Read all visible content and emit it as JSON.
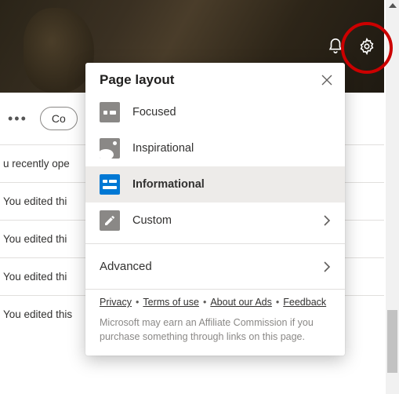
{
  "header": {
    "icons": {
      "bell": "notifications-icon",
      "gear": "settings-icon"
    }
  },
  "behind": {
    "pill": "Co",
    "lines": [
      "u recently ope",
      "You edited thi",
      "You edited thi",
      "You edited thi",
      "You edited this"
    ]
  },
  "panel": {
    "title": "Page layout",
    "options": [
      {
        "key": "focused",
        "label": "Focused",
        "selected": false,
        "chevron": false
      },
      {
        "key": "inspirational",
        "label": "Inspirational",
        "selected": false,
        "chevron": false
      },
      {
        "key": "informational",
        "label": "Informational",
        "selected": true,
        "chevron": false
      },
      {
        "key": "custom",
        "label": "Custom",
        "selected": false,
        "chevron": true
      }
    ],
    "advanced": "Advanced",
    "links": {
      "privacy": "Privacy",
      "terms": "Terms of use",
      "ads": "About our Ads",
      "feedback": "Feedback"
    },
    "disclaimer": "Microsoft may earn an Affiliate Commission if you purchase something through links on this page."
  }
}
